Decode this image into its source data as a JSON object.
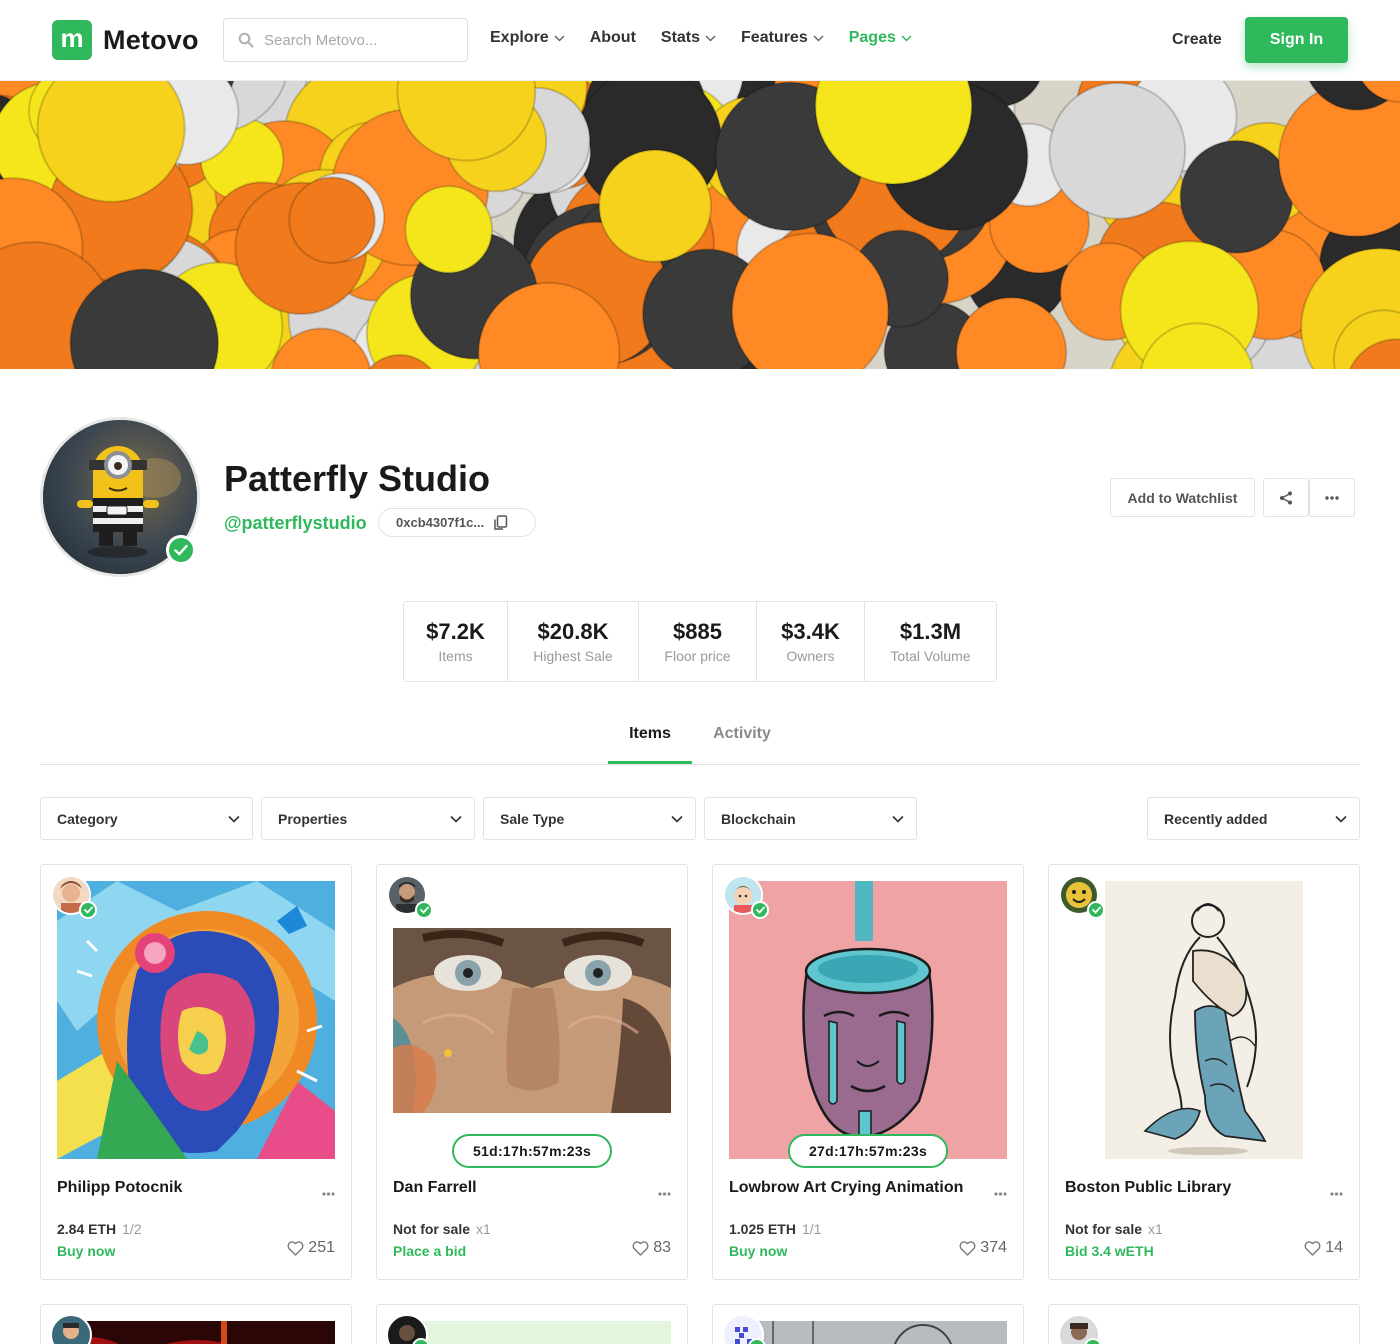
{
  "brand": {
    "logo_letter": "m",
    "name": "Metovo",
    "accent": "#2fb85c"
  },
  "search": {
    "placeholder": "Search Metovo..."
  },
  "nav": {
    "explore": "Explore",
    "about": "About",
    "stats": "Stats",
    "features": "Features",
    "pages": "Pages",
    "create": "Create",
    "sign_in": "Sign In"
  },
  "profile": {
    "name": "Patterfly Studio",
    "handle": "@patterflystudio",
    "wallet": "0xcb4307f1c...",
    "watchlist_label": "Add to Watchlist"
  },
  "stats": [
    {
      "value": "$7.2K",
      "label": "Items"
    },
    {
      "value": "$20.8K",
      "label": "Highest Sale"
    },
    {
      "value": "$885",
      "label": "Floor price"
    },
    {
      "value": "$3.4K",
      "label": "Owners"
    },
    {
      "value": "$1.3M",
      "label": "Total Volume"
    }
  ],
  "tabs": {
    "items": "Items",
    "activity": "Activity"
  },
  "filters": {
    "category": "Category",
    "properties": "Properties",
    "sale_type": "Sale Type",
    "blockchain": "Blockchain",
    "sort": "Recently added"
  },
  "cards": [
    {
      "title": "Philipp Potocnik",
      "price": "2.84 ETH",
      "edition": "1/2",
      "action": "Buy now",
      "likes": "251",
      "timer": ""
    },
    {
      "title": "Dan Farrell",
      "price": "Not for sale",
      "edition": "x1",
      "action": "Place a bid",
      "likes": "83",
      "timer": "51d:17h:57m:23s"
    },
    {
      "title": "Lowbrow Art Crying Animation",
      "price": "1.025 ETH",
      "edition": "1/1",
      "action": "Buy now",
      "likes": "374",
      "timer": "27d:17h:57m:23s"
    },
    {
      "title": "Boston Public Library",
      "price": "Not for sale",
      "edition": "x1",
      "action": "Bid 3.4 wETH",
      "likes": "14",
      "timer": ""
    }
  ]
}
